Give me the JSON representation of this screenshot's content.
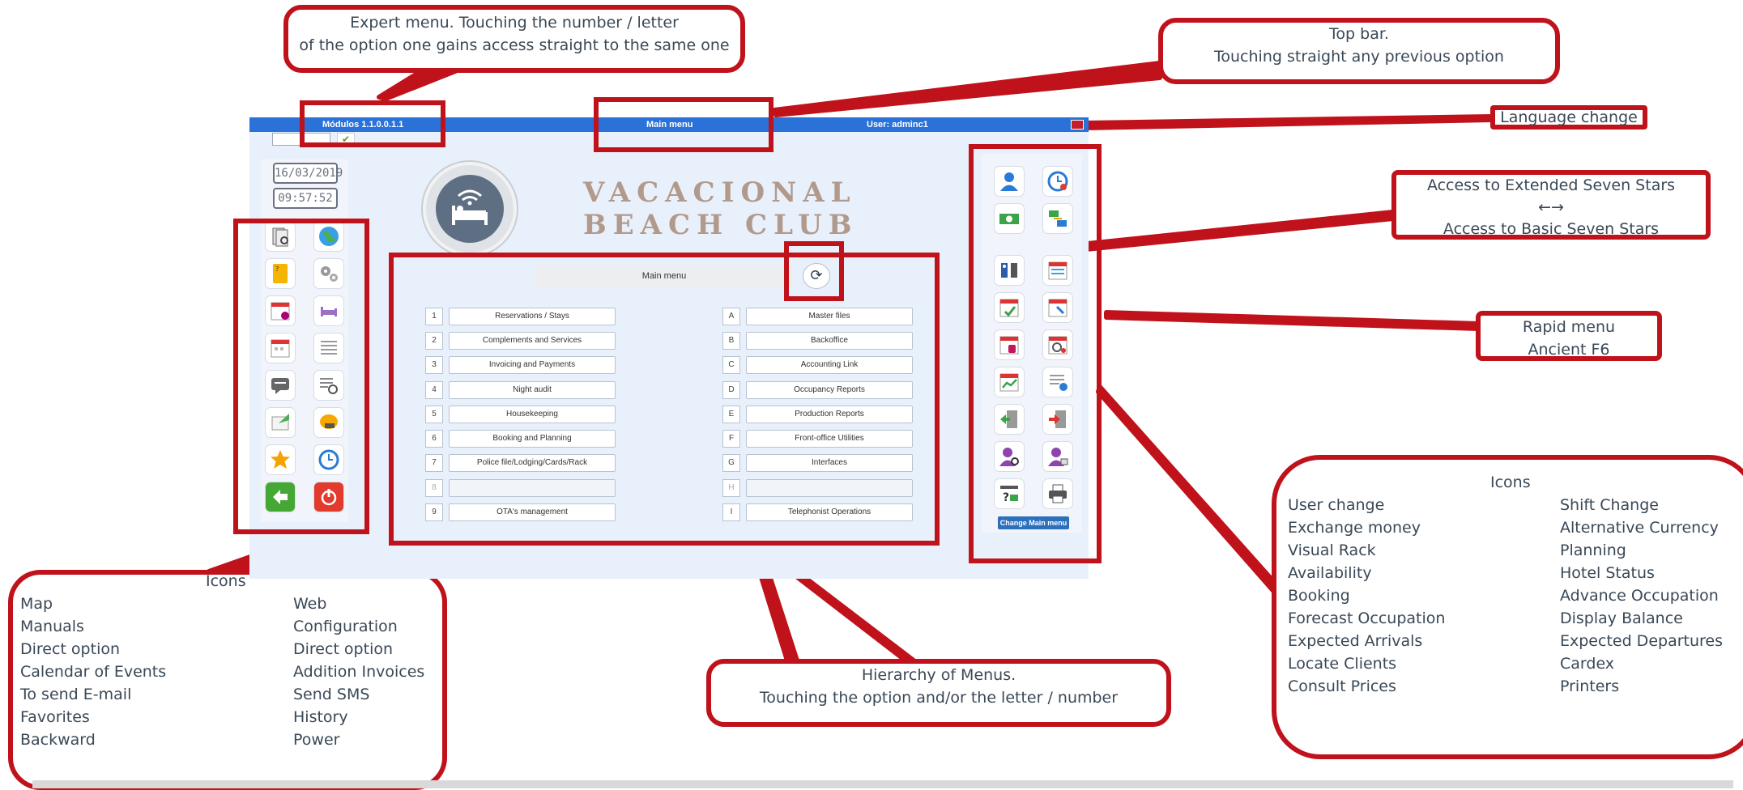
{
  "app": {
    "module_label": "Módulos 1.1.0.0.1.1",
    "menu_title": "Main menu",
    "user_label": "User: adminc1",
    "date": "16/03/2019",
    "time": "09:57:52",
    "brand": "VACACIONAL BEACH CLUB",
    "panel_title": "Main menu",
    "change_main_menu": "Change Main menu",
    "left_options": [
      {
        "key": "1",
        "label": "Reservations / Stays"
      },
      {
        "key": "2",
        "label": "Complements and Services"
      },
      {
        "key": "3",
        "label": "Invoicing and Payments"
      },
      {
        "key": "4",
        "label": "Night audit"
      },
      {
        "key": "5",
        "label": "Housekeeping"
      },
      {
        "key": "6",
        "label": "Booking and Planning"
      },
      {
        "key": "7",
        "label": "Police file/Lodging/Cards/Rack"
      },
      {
        "key": "8",
        "label": ""
      },
      {
        "key": "9",
        "label": "OTA's management"
      }
    ],
    "right_options": [
      {
        "key": "A",
        "label": "Master files"
      },
      {
        "key": "B",
        "label": "Backoffice"
      },
      {
        "key": "C",
        "label": "Accounting Link"
      },
      {
        "key": "D",
        "label": "Occupancy Reports"
      },
      {
        "key": "E",
        "label": "Production Reports"
      },
      {
        "key": "F",
        "label": "Front-office Utilities"
      },
      {
        "key": "G",
        "label": "Interfaces"
      },
      {
        "key": "H",
        "label": ""
      },
      {
        "key": "I",
        "label": "Telephonist Operations"
      }
    ]
  },
  "callouts": {
    "expert_menu": [
      "Expert menu. Touching the number / letter",
      "of the option one gains access straight to the same one"
    ],
    "top_bar": [
      "Top bar.",
      "Touching straight any previous option"
    ],
    "language_change": "Language change",
    "extended_access": [
      "Access to Extended Seven Stars",
      "←→",
      "Access to Basic Seven Stars"
    ],
    "rapid_menu": [
      "Rapid menu",
      "Ancient F6"
    ],
    "hierarchy": [
      "Hierarchy of Menus.",
      "Touching the option and/or the letter / number"
    ]
  },
  "left_legend": {
    "title": "Icons",
    "col1": [
      "Map",
      "Manuals",
      "Direct option",
      "Calendar of Events",
      "To send E-mail",
      "Favorites",
      "Backward"
    ],
    "col2": [
      "Web",
      "Configuration",
      "Direct option",
      "Addition Invoices",
      "Send SMS",
      "History",
      "Power"
    ]
  },
  "right_legend": {
    "title": "Icons",
    "col1": [
      "User change",
      "Exchange money",
      "Visual Rack",
      "Availability",
      "Booking",
      "Forecast Occupation",
      "Expected Arrivals",
      "Locate Clients",
      "Consult Prices"
    ],
    "col2": [
      "Shift Change",
      "Alternative Currency",
      "Planning",
      "Hotel Status",
      "Advance Occupation",
      "Display Balance",
      "Expected Departures",
      "Cardex",
      "Printers"
    ]
  },
  "colors": {
    "accent_red": "#c0121b",
    "topbar_blue": "#2a72d8"
  }
}
